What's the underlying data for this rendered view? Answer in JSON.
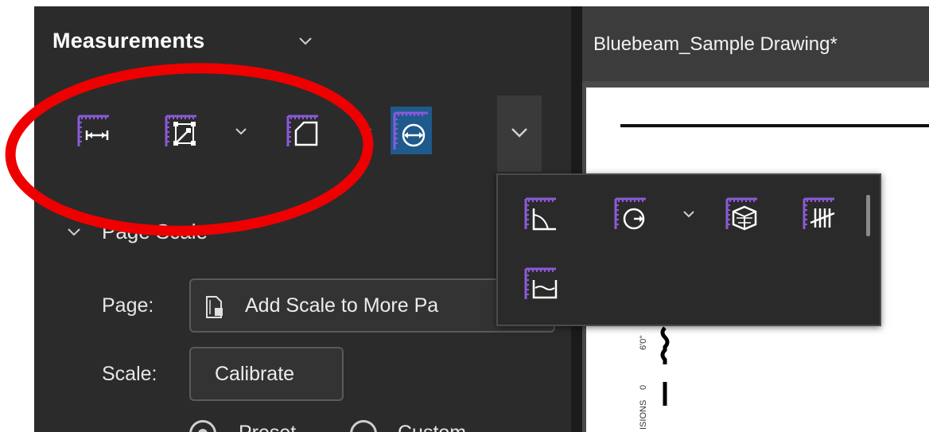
{
  "panel": {
    "title": "Measurements"
  },
  "document": {
    "tab_title": "Bluebeam_Sample Drawing*"
  },
  "page_scale": {
    "section_title": "Page Scale",
    "page_label": "Page:",
    "add_scale_label": "Add Scale to More Pa",
    "scale_label": "Scale:",
    "calibrate_label": "Calibrate",
    "preset_label": "Preset",
    "custom_label": "Custom"
  },
  "drawing": {
    "dim_text": "6'0\"",
    "zero_text": "0",
    "vertical_text": "ISIONS"
  },
  "colors": {
    "panel_bg": "#2b2b2b",
    "accent_active": "#1e5a8c",
    "icon_ruler": "#8a5ad6",
    "annotation_red": "#ee0000"
  },
  "toolbar": {
    "tools": [
      {
        "icon": "length-icon"
      },
      {
        "icon": "polylength-icon"
      },
      {
        "icon": "area-icon"
      },
      {
        "icon": "diameter-icon",
        "active": true
      }
    ]
  },
  "flyout": {
    "tools": [
      {
        "icon": "angle-icon"
      },
      {
        "icon": "radius-icon"
      },
      {
        "icon": "volume-icon"
      },
      {
        "icon": "count-icon"
      },
      {
        "icon": "wall-area-icon"
      }
    ]
  }
}
